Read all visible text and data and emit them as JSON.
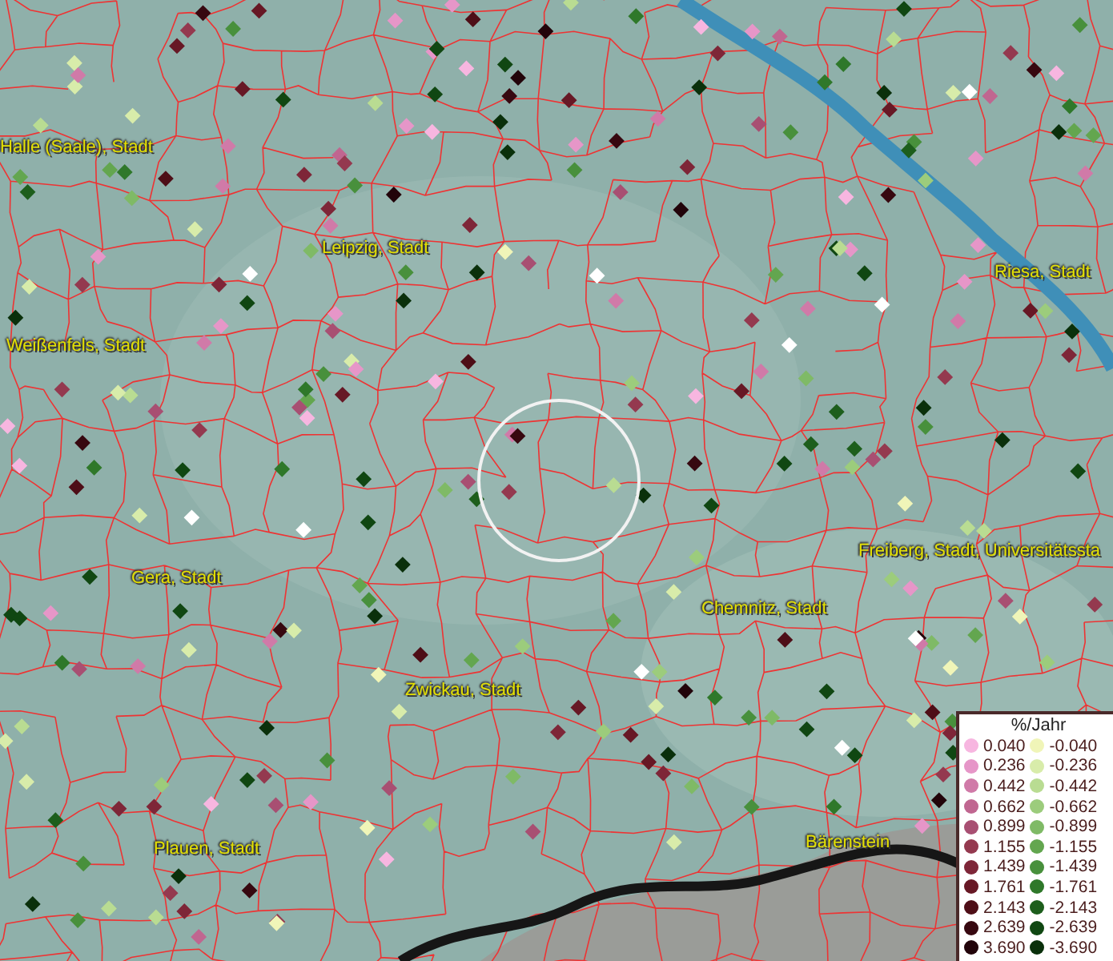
{
  "map": {
    "places": [
      {
        "name": "Halle (Saale), Stadt"
      },
      {
        "name": "Leipzig, Stadt"
      },
      {
        "name": "Weißenfels, Stadt"
      },
      {
        "name": "Riesa, Stadt"
      },
      {
        "name": "Freiberg, Stadt, Universitätssta"
      },
      {
        "name": "Gera, Stadt"
      },
      {
        "name": "Chemnitz, Stadt"
      },
      {
        "name": "Zwickau, Stadt"
      },
      {
        "name": "Plauen, Stadt"
      },
      {
        "name": "Bärenstein"
      }
    ]
  },
  "legend": {
    "title": "%/Jahr",
    "columns": [
      [
        {
          "label": "0.040",
          "color": "#f7b6e0"
        },
        {
          "label": "0.236",
          "color": "#e696c8"
        },
        {
          "label": "0.442",
          "color": "#d07aa8"
        },
        {
          "label": "0.662",
          "color": "#c06690"
        },
        {
          "label": "0.899",
          "color": "#a84f72"
        },
        {
          "label": "1.155",
          "color": "#94394f"
        },
        {
          "label": "1.439",
          "color": "#7e2638"
        },
        {
          "label": "1.761",
          "color": "#671825"
        },
        {
          "label": "2.143",
          "color": "#4e0e17"
        },
        {
          "label": "2.639",
          "color": "#370810"
        },
        {
          "label": "3.690",
          "color": "#22040a"
        }
      ],
      [
        {
          "label": "-0.040",
          "color": "#f0f5b8"
        },
        {
          "label": "-0.236",
          "color": "#d8ecaa"
        },
        {
          "label": "-0.442",
          "color": "#b9dc92"
        },
        {
          "label": "-0.662",
          "color": "#9ccc7c"
        },
        {
          "label": "-0.899",
          "color": "#7fba66"
        },
        {
          "label": "-1.155",
          "color": "#63a64f"
        },
        {
          "label": "-1.439",
          "color": "#48903c"
        },
        {
          "label": "-1.761",
          "color": "#2f782a"
        },
        {
          "label": "-2.143",
          "color": "#1d5e1c"
        },
        {
          "label": "-2.639",
          "color": "#104712"
        },
        {
          "label": "-3.690",
          "color": "#0a300b"
        }
      ]
    ]
  }
}
